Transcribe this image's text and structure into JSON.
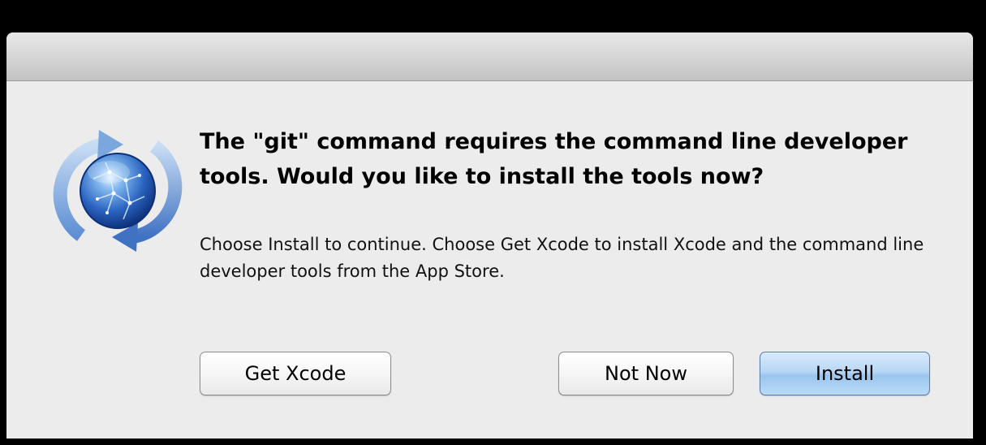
{
  "dialog": {
    "icon": "software-update-globe-icon",
    "message": "The \"git\" command requires the command line developer tools. Would you like to install the tools now?",
    "informative": "Choose Install to continue. Choose Get Xcode to install Xcode and the command line developer tools from the App Store.",
    "buttons": {
      "get_xcode": "Get Xcode",
      "not_now": "Not Now",
      "install": "Install"
    }
  },
  "colors": {
    "default_button": "#b8d7f4",
    "dialog_background": "#ececec"
  }
}
